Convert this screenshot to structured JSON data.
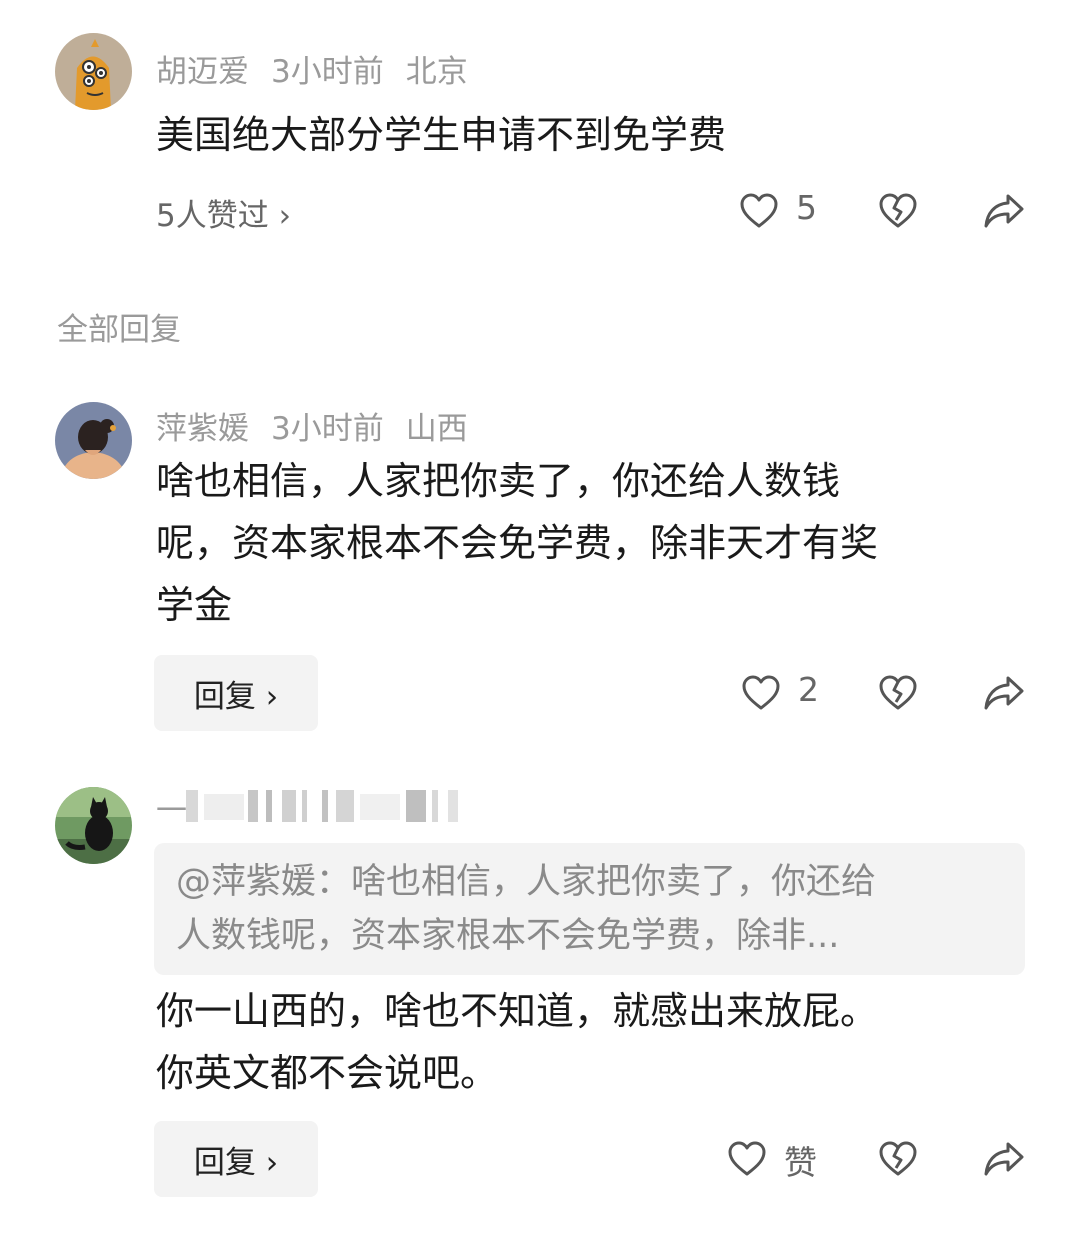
{
  "comment1": {
    "username": "胡迈爱",
    "time": "3小时前",
    "location": "北京",
    "text": "美国绝大部分学生申请不到免学费",
    "likers_text": "5人赞过 ›",
    "like_count": "5"
  },
  "section_title": "全部回复",
  "reply1": {
    "username": "萍紫媛",
    "time": "3小时前",
    "location": "山西",
    "text_line1": "啥也相信，人家把你卖了，你还给人数钱",
    "text_line2": "呢，资本家根本不会免学费，除非天才有奖",
    "text_line3": "学金",
    "reply_label": "回复 ›",
    "like_count": "2"
  },
  "reply2": {
    "username_prefix": "一",
    "quote_line1": "@萍紫媛：啥也相信，人家把你卖了，你还给",
    "quote_line2": "人数钱呢，资本家根本不会免学费，除非...",
    "text_line1": "你一山西的，啥也不知道，就感出来放屁。",
    "text_line2": "你英文都不会说吧。",
    "reply_label": "回复 ›",
    "like_label": "赞"
  },
  "colors": {
    "meta_gray": "#9a9a9a",
    "text_dark": "#1a1a1a",
    "button_bg": "#f3f3f3",
    "icon_gray": "#555555"
  },
  "icons": [
    "heart-outline-icon",
    "broken-heart-icon",
    "share-arrow-icon"
  ]
}
